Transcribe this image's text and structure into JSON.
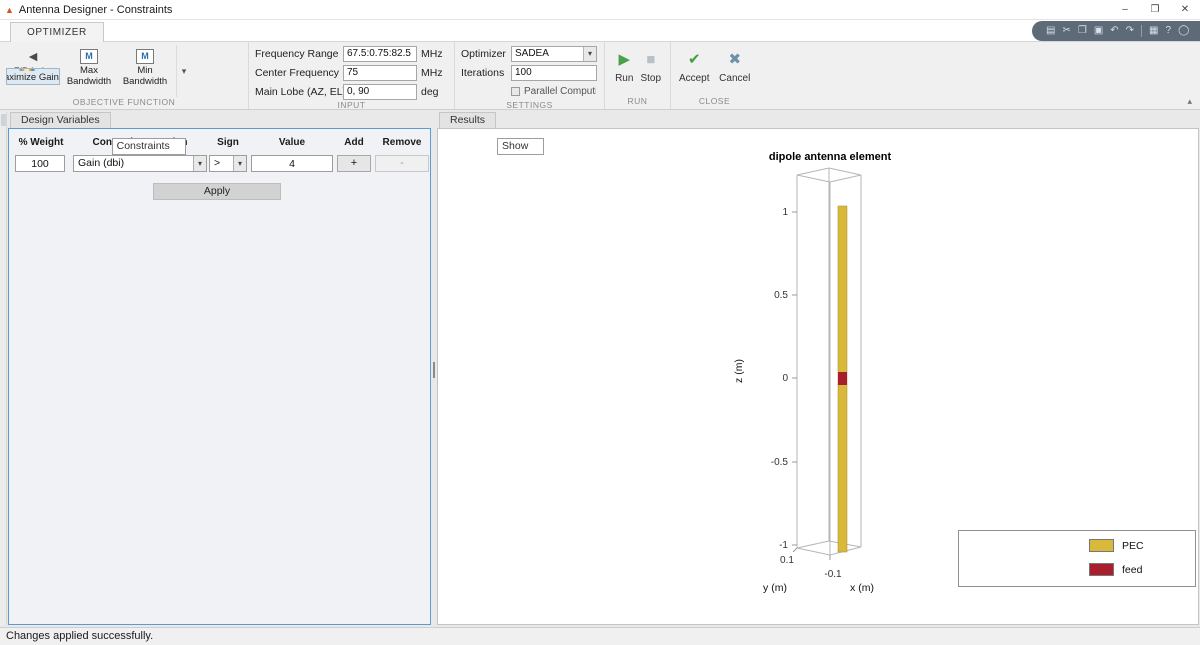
{
  "window": {
    "title": "Antenna Designer - Constraints"
  },
  "icons": {
    "logo": "▲",
    "save": "▤",
    "cut": "✂",
    "copy": "❐",
    "paste": "▣",
    "undo": "↶",
    "redo": "↷",
    "layout": "▦",
    "help": "?",
    "status": "◯",
    "minimize": "–",
    "maximize": "❐",
    "close": "✕",
    "dropdown": "▾",
    "collapse": "▴",
    "fb_lobe": "◄",
    "bandwidth": "M",
    "run": "▶",
    "stop": "■",
    "accept": "✔",
    "cancel": "✖"
  },
  "ribbon": {
    "tab": "OPTIMIZER",
    "objective": {
      "label": "OBJECTIVE FUNCTION",
      "buttons": [
        {
          "label": "Maximize Gain"
        },
        {
          "label": "F/B Lobe Ratio"
        },
        {
          "label": "Max Bandwidth"
        },
        {
          "label": "Min Bandwidth"
        }
      ]
    },
    "input": {
      "label": "INPUT",
      "rows": [
        {
          "label": "Frequency Range",
          "value": "67.5:0.75:82.5",
          "unit": "MHz"
        },
        {
          "label": "Center Frequency",
          "value": "75",
          "unit": "MHz"
        },
        {
          "label": "Main Lobe (AZ, EL)",
          "value": "0, 90",
          "unit": "deg"
        }
      ]
    },
    "settings": {
      "label": "SETTINGS",
      "optimizer_label": "Optimizer",
      "optimizer_value": "SADEA",
      "iterations_label": "Iterations",
      "iterations_value": "100",
      "parallel_label": "Parallel Computing"
    },
    "run": {
      "label": "RUN",
      "run": "Run",
      "stop": "Stop"
    },
    "close": {
      "label": "CLOSE",
      "accept": "Accept",
      "cancel": "Cancel"
    }
  },
  "left_panel": {
    "tabs": [
      "Design Variables",
      "Constraints"
    ],
    "table": {
      "headers": [
        "% Weight",
        "Constraint Function",
        "Sign",
        "Value",
        "Add",
        "Remove"
      ],
      "row": {
        "weight": "100",
        "function": "Gain (dbi)",
        "sign": ">",
        "value": "4",
        "add": "+",
        "remove": "-"
      }
    },
    "apply": "Apply"
  },
  "right_panel": {
    "tabs": [
      "Results",
      "Show"
    ]
  },
  "plot": {
    "title": "dipole antenna element",
    "xlabel": "x (m)",
    "ylabel": "y (m)",
    "zlabel": "z (m)",
    "z_ticks": [
      "1",
      "0.5",
      "0",
      "-0.5",
      "-1"
    ],
    "y_tick": "0.1",
    "x_tick": "-0.1",
    "legend": [
      {
        "label": "PEC",
        "color": "#d9b93c"
      },
      {
        "label": "feed",
        "color": "#a81e2c"
      }
    ]
  },
  "statusbar": {
    "text": "Changes applied successfully."
  },
  "colors": {
    "pec": "#d9b93c",
    "feed": "#a81e2c",
    "panel_border": "#5b9bd5"
  }
}
